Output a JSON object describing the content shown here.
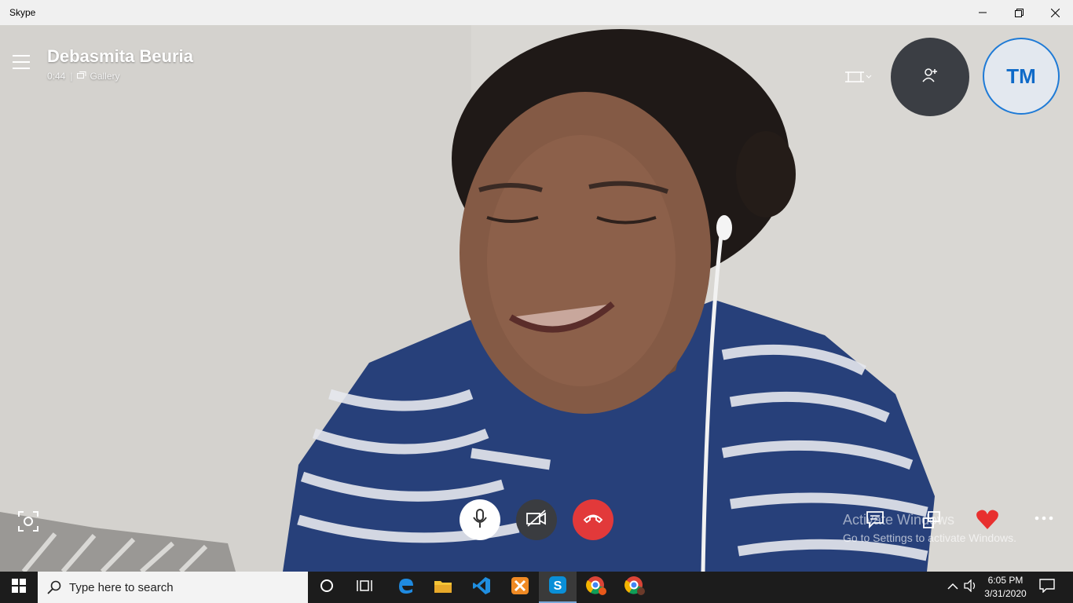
{
  "window": {
    "title": "Skype"
  },
  "call": {
    "caller_name": "Debasmita Beuria",
    "duration": "0:44",
    "separator": "|",
    "view_mode": "Gallery",
    "self_initials": "TM"
  },
  "watermark": {
    "line1": "Activate Windows",
    "line2": "Go to Settings to activate Windows."
  },
  "taskbar": {
    "search_placeholder": "Type here to search",
    "time": "6:05 PM",
    "date": "3/31/2020"
  },
  "colors": {
    "end_call": "#e2393a",
    "avatar_ring": "#1e7ad6",
    "avatar_text": "#0f6ac8",
    "heart": "#e8302f",
    "taskbar": "#1c1c1c"
  },
  "icons": {
    "minimize": "minimize-icon",
    "maximize": "restore-icon",
    "close": "close-icon",
    "menu": "hamburger-icon",
    "gallery": "gallery-icon",
    "crop": "screen-fit-icon",
    "add_people": "add-person-icon",
    "snapshot": "snapshot-icon",
    "mic": "microphone-icon",
    "camera_off": "camera-off-icon",
    "hang_up": "hang-up-icon",
    "chat": "chat-icon",
    "share_screen": "share-screen-icon",
    "reaction": "heart-icon",
    "more": "more-dots-icon"
  }
}
